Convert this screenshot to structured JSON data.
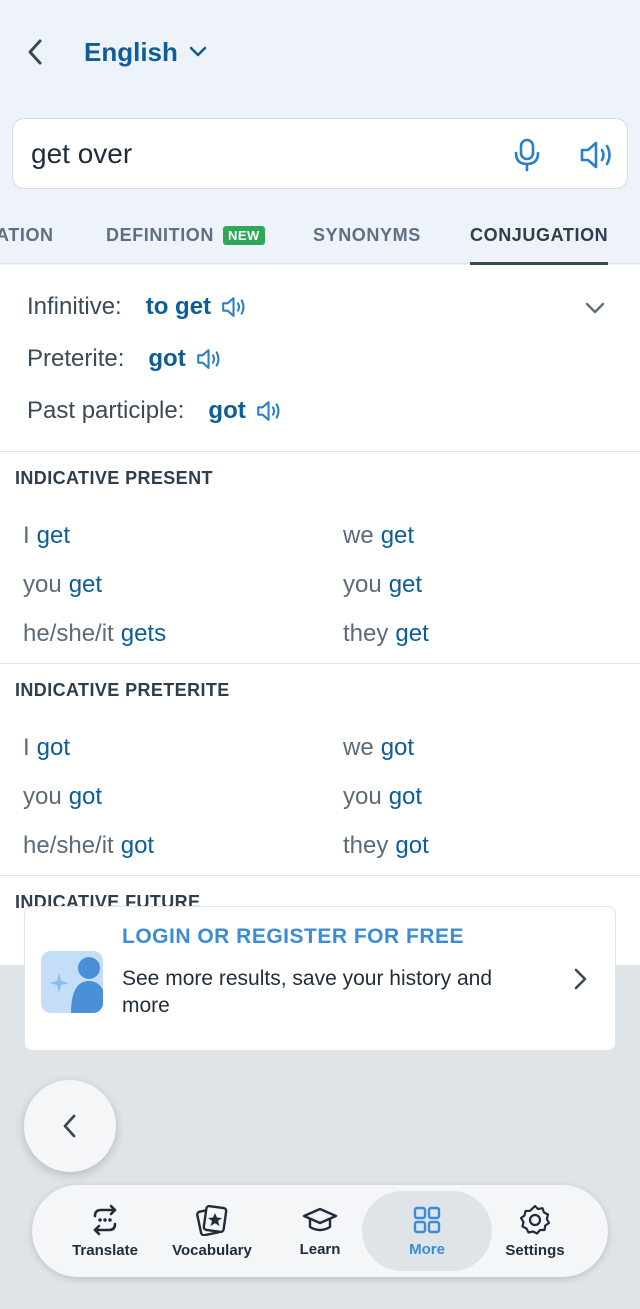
{
  "header": {
    "language": "English"
  },
  "search": {
    "query": "get over"
  },
  "tabs": [
    {
      "label": "ATION"
    },
    {
      "label": "DEFINITION",
      "badge": "NEW"
    },
    {
      "label": "SYNONYMS"
    },
    {
      "label": "CONJUGATION",
      "active": true
    }
  ],
  "forms": {
    "infinitive_label": "Infinitive:",
    "infinitive_value": "to get",
    "preterite_label": "Preterite:",
    "preterite_value": "got",
    "participle_label": "Past participle:",
    "participle_value": "got"
  },
  "sections": [
    {
      "title": "INDICATIVE PRESENT",
      "rows": [
        {
          "p1": "I",
          "v1": "get",
          "p2": "we",
          "v2": "get"
        },
        {
          "p1": "you",
          "v1": "get",
          "p2": "you",
          "v2": "get"
        },
        {
          "p1": "he/she/it",
          "v1": "gets",
          "p2": "they",
          "v2": "get"
        }
      ]
    },
    {
      "title": "INDICATIVE PRETERITE",
      "rows": [
        {
          "p1": "I",
          "v1": "got",
          "p2": "we",
          "v2": "got"
        },
        {
          "p1": "you",
          "v1": "got",
          "p2": "you",
          "v2": "got"
        },
        {
          "p1": "he/she/it",
          "v1": "got",
          "p2": "they",
          "v2": "got"
        }
      ]
    },
    {
      "title": "INDICATIVE FUTURE"
    }
  ],
  "login": {
    "title": "LOGIN OR REGISTER FOR FREE",
    "text": "See more results, save your history and more"
  },
  "nav": {
    "translate": "Translate",
    "vocabulary": "Vocabulary",
    "learn": "Learn",
    "more": "More",
    "settings": "Settings",
    "active": "more"
  },
  "colors": {
    "accent": "#0d5e96",
    "link": "#3a8dd4",
    "badge": "#2fa85a"
  }
}
